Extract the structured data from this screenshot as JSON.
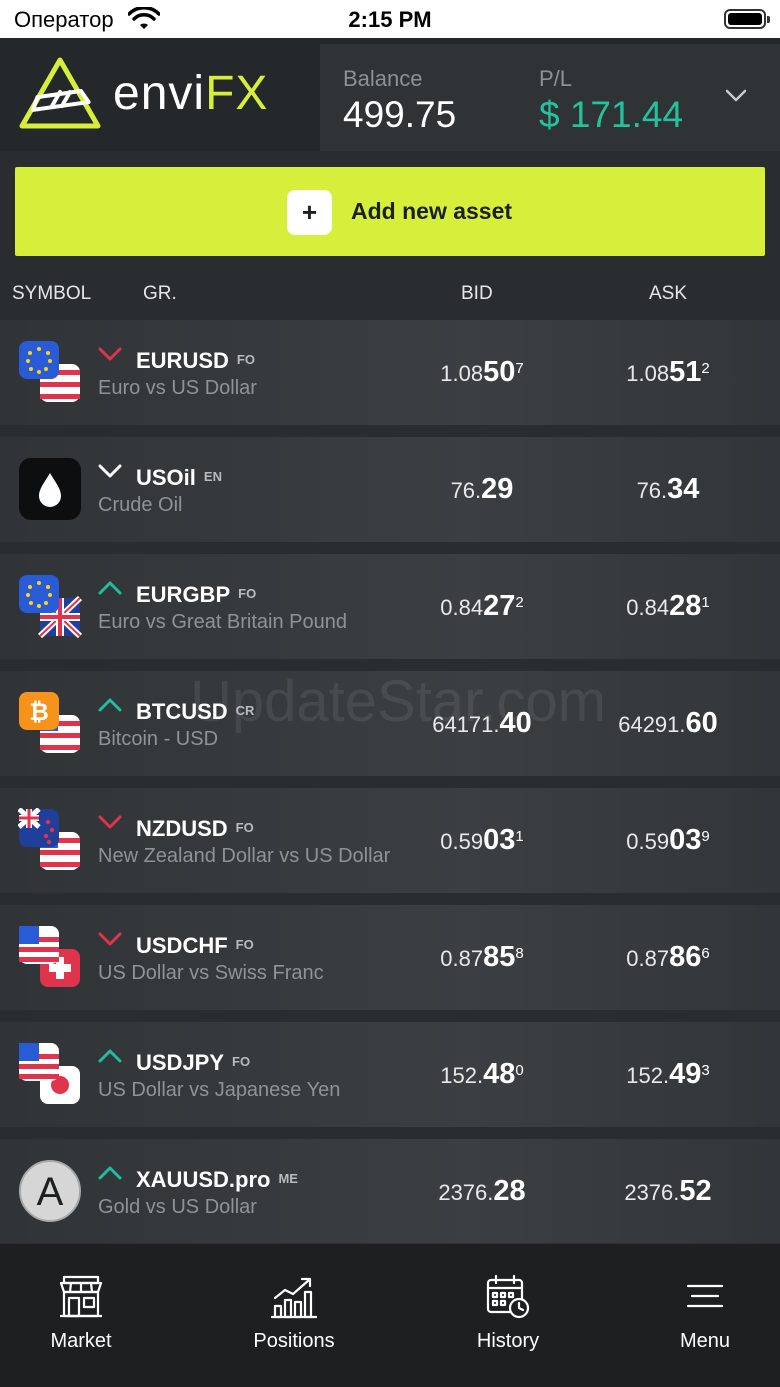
{
  "status_bar": {
    "carrier": "Оператор",
    "time": "2:15 PM"
  },
  "header": {
    "logo_text": "envi",
    "logo_accent": "FX",
    "balance_label": "Balance",
    "balance_value": "499.75",
    "pl_label": "P/L",
    "pl_value": "$ 171.44"
  },
  "add_asset": {
    "plus": "+",
    "label": "Add new asset"
  },
  "columns": {
    "symbol": "SYMBOL",
    "group": "GR.",
    "bid": "BID",
    "ask": "ASK"
  },
  "assets": [
    {
      "symbol": "EURUSD",
      "group": "FO",
      "description": "Euro vs US Dollar",
      "direction": "down",
      "icon": "eu-us-flags-icon",
      "bid": {
        "lo": "1.08",
        "hi": "50",
        "sup": "7"
      },
      "ask": {
        "lo": "1.08",
        "hi": "51",
        "sup": "2"
      }
    },
    {
      "symbol": "USOil",
      "group": "EN",
      "description": "Crude Oil",
      "direction": "neutral",
      "icon": "oil-drop-icon",
      "bid": {
        "lo": "76.",
        "hi": "29",
        "sup": ""
      },
      "ask": {
        "lo": "76.",
        "hi": "34",
        "sup": ""
      }
    },
    {
      "symbol": "EURGBP",
      "group": "FO",
      "description": "Euro vs Great Britain Pound",
      "direction": "up",
      "icon": "eu-uk-flags-icon",
      "bid": {
        "lo": "0.84",
        "hi": "27",
        "sup": "2"
      },
      "ask": {
        "lo": "0.84",
        "hi": "28",
        "sup": "1"
      }
    },
    {
      "symbol": "BTCUSD",
      "group": "CR",
      "description": "Bitcoin - USD",
      "direction": "up",
      "icon": "bitcoin-us-icon",
      "bid": {
        "lo": "64171.",
        "hi": "40",
        "sup": ""
      },
      "ask": {
        "lo": "64291.",
        "hi": "60",
        "sup": ""
      }
    },
    {
      "symbol": "NZDUSD",
      "group": "FO",
      "description": "New Zealand Dollar vs US Dollar",
      "direction": "down",
      "icon": "nz-us-flags-icon",
      "bid": {
        "lo": "0.59",
        "hi": "03",
        "sup": "1"
      },
      "ask": {
        "lo": "0.59",
        "hi": "03",
        "sup": "9"
      }
    },
    {
      "symbol": "USDCHF",
      "group": "FO",
      "description": "US Dollar vs Swiss Franc",
      "direction": "down",
      "icon": "us-ch-flags-icon",
      "bid": {
        "lo": "0.87",
        "hi": "85",
        "sup": "8"
      },
      "ask": {
        "lo": "0.87",
        "hi": "86",
        "sup": "6"
      }
    },
    {
      "symbol": "USDJPY",
      "group": "FO",
      "description": "US Dollar vs Japanese Yen",
      "direction": "up",
      "icon": "us-jp-flags-icon",
      "bid": {
        "lo": "152.",
        "hi": "48",
        "sup": "0"
      },
      "ask": {
        "lo": "152.",
        "hi": "49",
        "sup": "3"
      }
    },
    {
      "symbol": "XAUUSD.pro",
      "group": "ME",
      "description": "Gold vs US Dollar",
      "direction": "up",
      "icon": "letter-a-avatar-icon",
      "bid": {
        "lo": "2376.",
        "hi": "28",
        "sup": ""
      },
      "ask": {
        "lo": "2376.",
        "hi": "52",
        "sup": ""
      }
    }
  ],
  "watermark": "UpdateStar.com",
  "tabs": [
    {
      "label": "Market",
      "icon": "store-icon"
    },
    {
      "label": "Positions",
      "icon": "chart-up-icon"
    },
    {
      "label": "History",
      "icon": "calendar-clock-icon"
    },
    {
      "label": "Menu",
      "icon": "hamburger-icon"
    }
  ],
  "colors": {
    "accent": "#d6ef3a",
    "profit": "#22c39a",
    "down": "#e0344c",
    "up": "#1fbf9d"
  }
}
